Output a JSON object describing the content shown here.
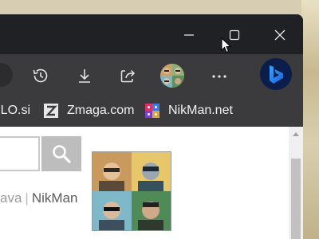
{
  "window": {
    "minimize_icon": "minimize-icon",
    "maximize_icon": "maximize-icon",
    "close_icon": "close-icon"
  },
  "toolbar": {
    "history_icon": "history-icon",
    "downloads_icon": "download-icon",
    "share_icon": "share-icon",
    "more_icon": "more-dots-icon",
    "copilot_icon": "bing-copilot-icon"
  },
  "bookmarks": [
    {
      "label": "SLO.si"
    },
    {
      "label": "Zmaga.com"
    },
    {
      "label": "NikMan.net"
    }
  ],
  "page": {
    "footer_fragment": "ava",
    "separator": "|",
    "footer_name": "NikMan"
  },
  "colors": {
    "window_bg": "#202124",
    "toolbar_bg": "#3b3b3d",
    "copilot_blue": "#2f7bf0"
  }
}
